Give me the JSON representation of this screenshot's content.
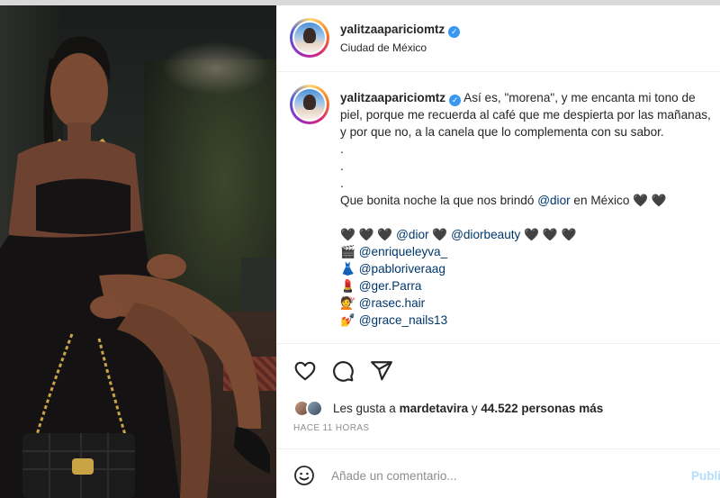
{
  "post": {
    "username": "yalitzaapariciomtz",
    "location": "Ciudad de México"
  },
  "caption": {
    "username": "yalitzaapariciomtz",
    "text": "Así es, \"morena\", y me encanta mi tono de piel, porque me recuerda al café que me despierta por las mañanas, y por que no, a la canela que lo complementa con su sabor.",
    "dots": [
      ".",
      ".",
      "."
    ],
    "line_before": "Que bonita noche la que nos brindó ",
    "line_mention": "@dior",
    "line_after": " en México 🖤 🖤",
    "hearts_line": {
      "prefix": "🖤 🖤 🖤 ",
      "mention1": "@dior",
      "middle": " 🖤 ",
      "mention2": "@diorbeauty",
      "suffix": " 🖤 🖤 🖤"
    },
    "credits": [
      {
        "emoji": "🎬",
        "handle": "@enriqueleyva_"
      },
      {
        "emoji": "👗",
        "handle": "@pabloriveraag"
      },
      {
        "emoji": "💄",
        "handle": "@ger.Parra"
      },
      {
        "emoji": "💇",
        "handle": "@rasec.hair"
      },
      {
        "emoji": "💅",
        "handle": "@grace_nails13"
      }
    ]
  },
  "likes": {
    "prefix": "Les gusta a ",
    "user": "mardetavira",
    "middle": " y ",
    "count": "44.522 personas más"
  },
  "time": "HACE 11 HORAS",
  "comment": {
    "placeholder": "Añade un comentario...",
    "publish": "Publicar"
  },
  "colors": {
    "mention": "#00376b",
    "verified": "#3897f0",
    "publish_disabled": "#b2dffc"
  }
}
